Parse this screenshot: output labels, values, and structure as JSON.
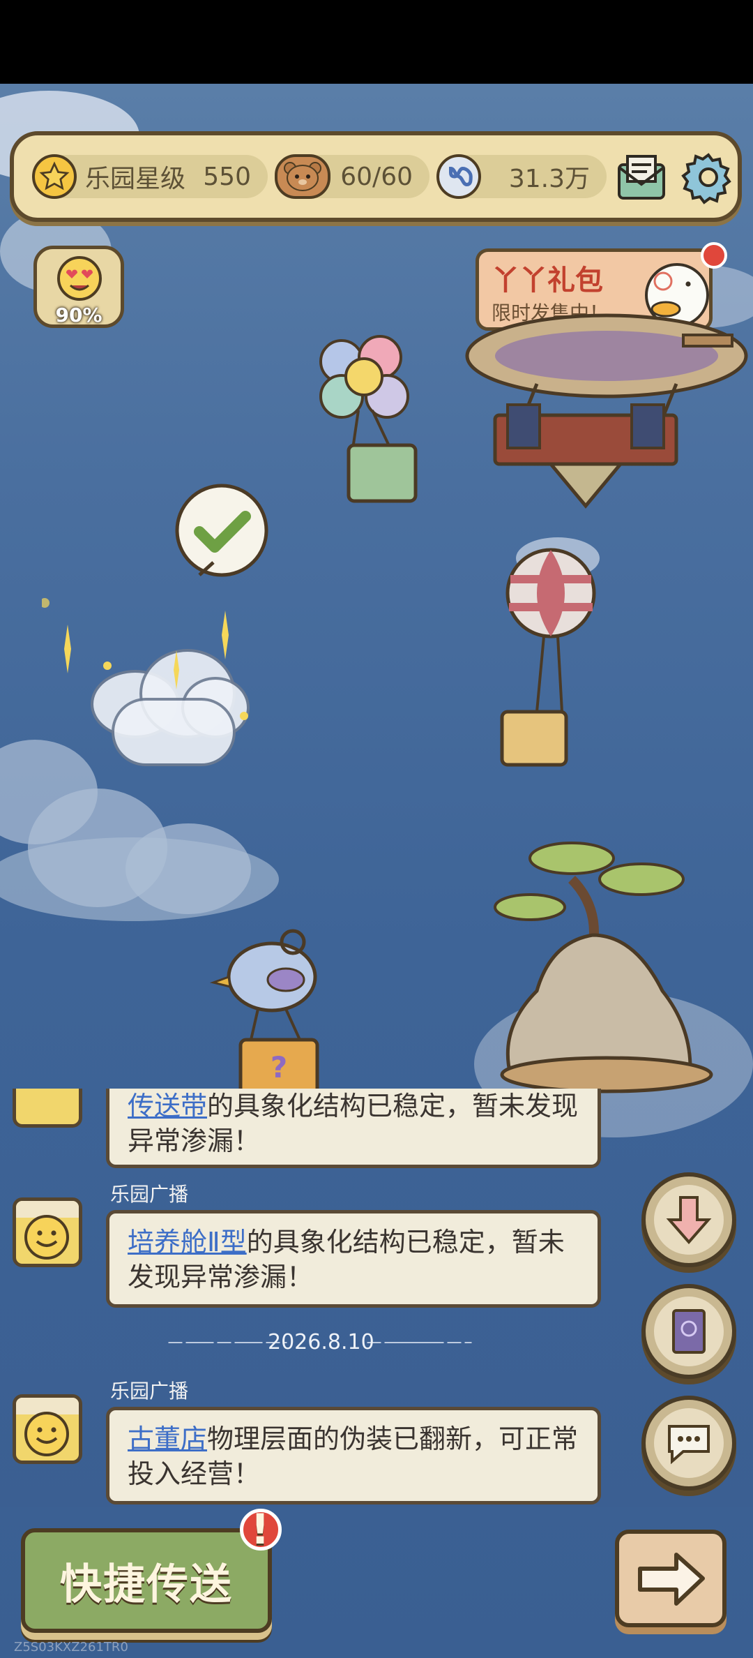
{
  "top_bar": {
    "star_label": "乐园星级",
    "star_value": "550",
    "bear_value": "60/60",
    "currency_value": "31.3万",
    "icons": [
      "star-icon",
      "bear-icon",
      "infinity-coin-icon",
      "mail-icon",
      "gear-icon"
    ]
  },
  "mood": {
    "percent": "90%",
    "level": 0.9
  },
  "gift": {
    "title": "丫丫礼包",
    "subtitle": "限时发售中！"
  },
  "chat": {
    "partial_message": {
      "link": "传送带",
      "text": "的具象化结构已稳定，暂未发现异常渗漏！"
    },
    "messages": [
      {
        "sender": "乐园广播",
        "link": "培养舱Ⅱ型",
        "text": "的具象化结构已稳定，暂未发现异常渗漏！"
      },
      {
        "sender": "乐园广播",
        "link": "古董店",
        "text": "物理层面的伪装已翻新，可正常投入经营！"
      }
    ],
    "date": "2026.8.10"
  },
  "buttons": {
    "quick_teleport": "快捷传送",
    "quick_badge": "!"
  },
  "watermark": "Z5S03KXZ261TR0",
  "colors": {
    "sky": "#3e6497",
    "panel": "#efdfae",
    "outline": "#5d4a2c",
    "link": "#3d6ec7"
  }
}
